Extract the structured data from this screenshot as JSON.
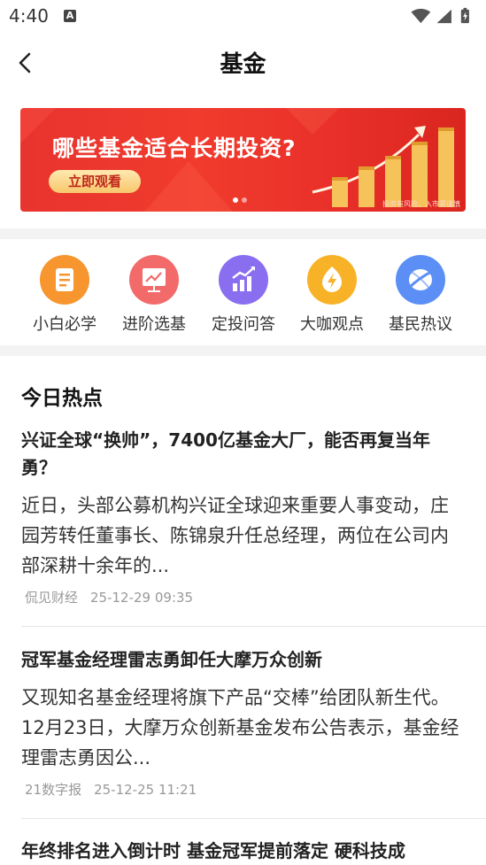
{
  "status_bar": {
    "time": "4:40",
    "badge": "A"
  },
  "header": {
    "title": "基金"
  },
  "banner": {
    "headline": "哪些基金适合长期投资?",
    "cta": "立即观看",
    "disclaimer": "投资有风险，入市需谨慎",
    "slides": 2,
    "active_slide": 1
  },
  "shortcuts": [
    {
      "label": "小白必学",
      "icon": "notebook-icon",
      "color": "#f7952e"
    },
    {
      "label": "进阶选基",
      "icon": "presentation-chart-icon",
      "color": "#f26a6a"
    },
    {
      "label": "定投问答",
      "icon": "growth-chart-icon",
      "color": "#8a6ef0"
    },
    {
      "label": "大咖观点",
      "icon": "lightning-icon",
      "color": "#f7b228"
    },
    {
      "label": "基民热议",
      "icon": "chat-bubbles-icon",
      "color": "#5c8ff5"
    }
  ],
  "hot": {
    "title": "今日热点",
    "articles": [
      {
        "title": "兴证全球“换帅”，7400亿基金大厂，能否再复当年勇？",
        "body": "近日，头部公募机构兴证全球迎来重要人事变动，庄园芳转任董事长、陈锦泉升任总经理，两位在公司内部深耕十余年的...",
        "source": "侃见财经",
        "time": "25-12-29 09:35"
      },
      {
        "title": "冠军基金经理雷志勇卸任大摩万众创新",
        "body": "又现知名基金经理将旗下产品“交棒”给团队新生代。12月23日，大摩万众创新基金发布公告表示，基金经理雷志勇因公...",
        "source": "21数字报",
        "time": "25-12-25 11:21"
      },
      {
        "title": "年终排名进入倒计时 基金冠军提前落定 硬科技成",
        "body": "",
        "source": "",
        "time": ""
      }
    ]
  }
}
